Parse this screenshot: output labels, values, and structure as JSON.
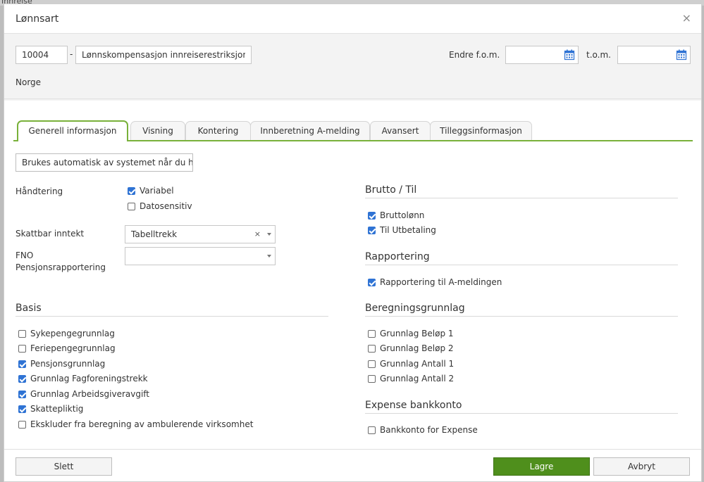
{
  "background": {
    "text": "Innreise"
  },
  "dialog": {
    "title": "Lønnsart",
    "close_symbol": "×"
  },
  "header": {
    "code_value": "10004",
    "separator": "-",
    "name_value": "Lønnskompensasjon innreiserestriksjoner",
    "change_from_label": "Endre f.o.m.",
    "to_label": "t.o.m.",
    "country": "Norge"
  },
  "tabs": [
    {
      "label": "Generell informasjon",
      "active": true
    },
    {
      "label": "Visning"
    },
    {
      "label": "Kontering"
    },
    {
      "label": "Innberetning A-melding"
    },
    {
      "label": "Avansert"
    },
    {
      "label": "Tilleggsinformasjon"
    }
  ],
  "general": {
    "auto_text": "Brukes automatisk av systemet når du ha",
    "handling_label": "Håndtering",
    "handling": [
      {
        "label": "Variabel",
        "checked": true
      },
      {
        "label": "Datosensitiv",
        "checked": false
      }
    ],
    "taxable_label": "Skattbar inntekt",
    "taxable_value": "Tabelltrekk",
    "clear_symbol": "×",
    "fno_label_1": "FNO",
    "fno_label_2": "Pensjonsrapportering",
    "fno_value": ""
  },
  "basis": {
    "title": "Basis",
    "items": [
      {
        "label": "Sykepengegrunnlag",
        "checked": false
      },
      {
        "label": "Feriepengegrunnlag",
        "checked": false
      },
      {
        "label": "Pensjonsgrunnlag",
        "checked": true
      },
      {
        "label": "Grunnlag Fagforeningstrekk",
        "checked": true
      },
      {
        "label": "Grunnlag Arbeidsgiveravgift",
        "checked": true
      },
      {
        "label": "Skattepliktig",
        "checked": true
      },
      {
        "label": "Ekskluder fra beregning av ambulerende virksomhet",
        "checked": false
      }
    ]
  },
  "brutto": {
    "title": "Brutto / Til",
    "items": [
      {
        "label": "Bruttolønn",
        "checked": true
      },
      {
        "label": "Til Utbetaling",
        "checked": true
      }
    ]
  },
  "reporting": {
    "title": "Rapportering",
    "items": [
      {
        "label": "Rapportering til A-meldingen",
        "checked": true
      }
    ]
  },
  "calc_basis": {
    "title": "Beregningsgrunnlag",
    "items": [
      {
        "label": "Grunnlag Beløp 1",
        "checked": false
      },
      {
        "label": "Grunnlag Beløp 2",
        "checked": false
      },
      {
        "label": "Grunnlag Antall 1",
        "checked": false
      },
      {
        "label": "Grunnlag Antall 2",
        "checked": false
      }
    ]
  },
  "expense": {
    "title": "Expense bankkonto",
    "items": [
      {
        "label": "Bankkonto for Expense",
        "checked": false
      }
    ]
  },
  "footer": {
    "delete_label": "Slett",
    "save_label": "Lagre",
    "cancel_label": "Avbryt"
  },
  "colors": {
    "accent_green": "#79b13a",
    "save_green": "#4f8f1c",
    "checkbox_blue": "#2f73d4"
  },
  "icons": [
    "calendar-icon",
    "close-icon",
    "chevron-down-icon",
    "clear-icon"
  ]
}
